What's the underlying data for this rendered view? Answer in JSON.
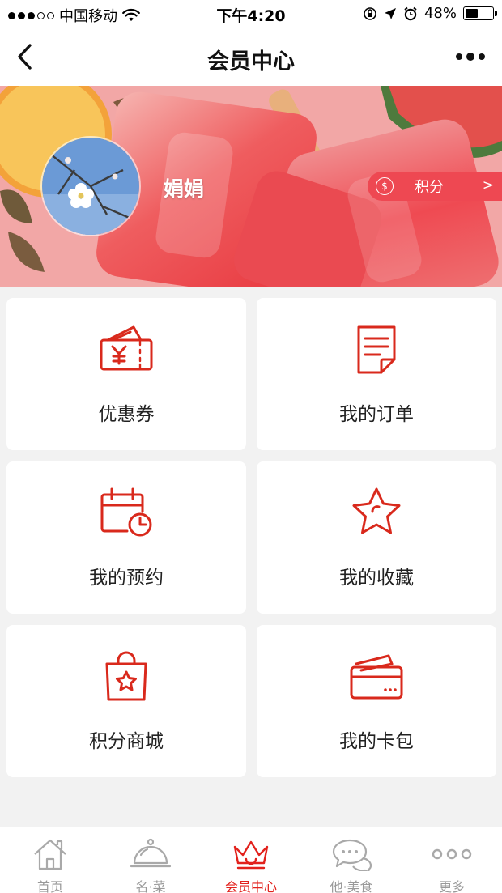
{
  "status_bar": {
    "carrier": "中国移动",
    "time": "下午4:20",
    "battery_text": "48%",
    "battery_level": 0.48,
    "signal_icon": "signal-dots-icon",
    "wifi_icon": "wifi-icon",
    "orientation_lock_icon": "orientation-lock-icon",
    "location_icon": "location-arrow-icon",
    "alarm_icon": "alarm-icon"
  },
  "nav": {
    "title": "会员中心",
    "back_icon": "chevron-left-icon",
    "more_icon": "more-dots-icon"
  },
  "profile": {
    "name": "娟娟",
    "points_label": "积分",
    "points_arrow": ">"
  },
  "grid": [
    {
      "label": "优惠券",
      "icon": "coupon-icon"
    },
    {
      "label": "我的订单",
      "icon": "order-document-icon"
    },
    {
      "label": "我的预约",
      "icon": "calendar-clock-icon"
    },
    {
      "label": "我的收藏",
      "icon": "star-icon"
    },
    {
      "label": "积分商城",
      "icon": "shopping-bag-star-icon"
    },
    {
      "label": "我的卡包",
      "icon": "card-wallet-icon"
    }
  ],
  "tabs": [
    {
      "label": "首页",
      "icon": "home-icon",
      "active": false
    },
    {
      "label": "名·菜",
      "icon": "cloche-icon",
      "active": false
    },
    {
      "label": "会员中心",
      "icon": "crown-icon",
      "active": true
    },
    {
      "label": "他·美食",
      "icon": "chat-bubbles-icon",
      "active": false
    },
    {
      "label": "更多",
      "icon": "more-circles-icon",
      "active": false
    }
  ],
  "colors": {
    "accent": "#e2211c",
    "points_pill": "#ee4852",
    "tab_inactive": "#999999",
    "icon_red": "#d9291c"
  }
}
